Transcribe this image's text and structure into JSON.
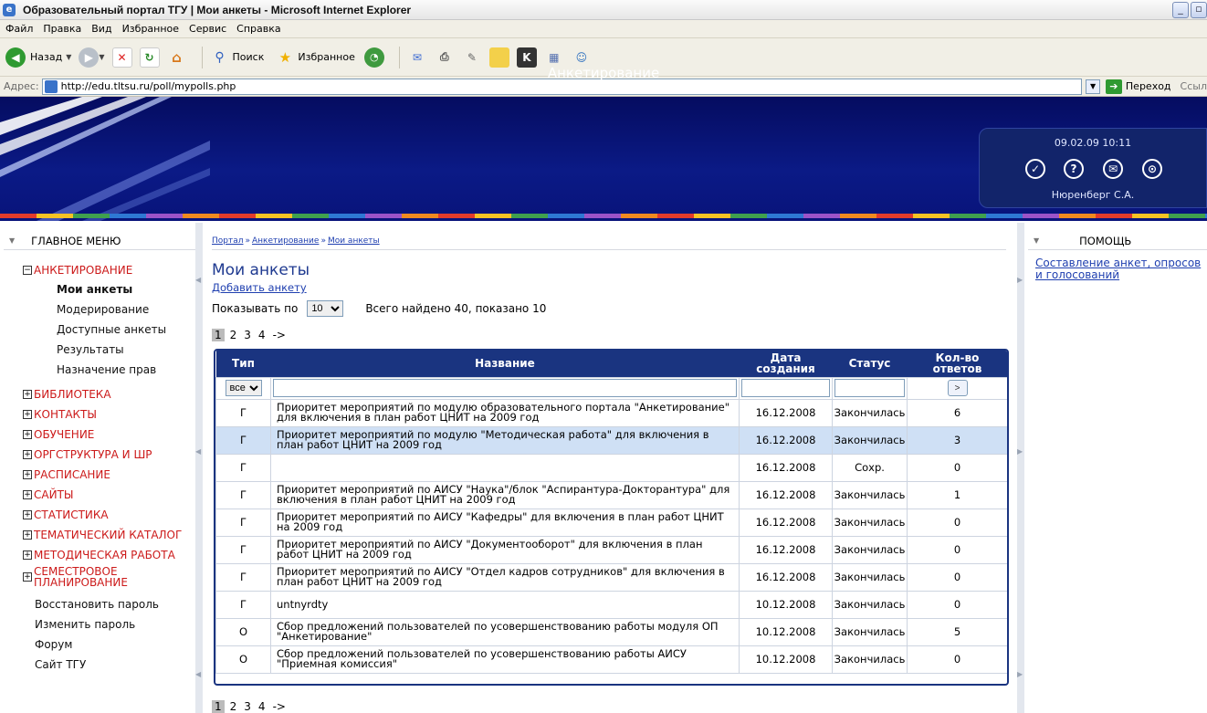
{
  "window": {
    "title": "Образовательный портал ТГУ | Мои анкеты - Microsoft Internet Explorer"
  },
  "menubar": [
    "Файл",
    "Правка",
    "Вид",
    "Избранное",
    "Сервис",
    "Справка"
  ],
  "toolbar": {
    "back": "Назад",
    "search": "Поиск",
    "favorites": "Избранное"
  },
  "address": {
    "label": "Адрес:",
    "url": "http://edu.tltsu.ru/poll/mypolls.php",
    "go": "Переход",
    "links": "Ссыл"
  },
  "header": {
    "title": "Анкетирование",
    "datetime": "09.02.09 10:11",
    "user": "Нюренберг С.А."
  },
  "left_menu": {
    "title": "ГЛАВНОЕ МЕНЮ",
    "active_section": "АНКЕТИРОВАНИЕ",
    "sub_items": [
      "Мои анкеты",
      "Модерирование",
      "Доступные анкеты",
      "Результаты",
      "Назначение прав"
    ],
    "sections": [
      "БИБЛИОТЕКА",
      "КОНТАКТЫ",
      "ОБУЧЕНИЕ",
      "ОРГСТРУКТУРА И ШР",
      "РАСПИСАНИЕ",
      "САЙТЫ",
      "СТАТИСТИКА",
      "ТЕМАТИЧЕСКИЙ КАТАЛОГ",
      "МЕТОДИЧЕСКАЯ РАБОТА"
    ],
    "semester_line1": "СЕМЕСТРОВОЕ",
    "semester_line2": "ПЛАНИРОВАНИЕ",
    "misc": [
      "Восстановить пароль",
      "Изменить пароль",
      "Форум",
      "Сайт ТГУ"
    ]
  },
  "breadcrumb": {
    "portal": "Портал",
    "section": "Анкетирование",
    "current": "Мои анкеты",
    "separator": "»"
  },
  "main": {
    "title": "Мои анкеты",
    "add_link": "Добавить анкету",
    "show_label": "Показывать по",
    "per_page": "10",
    "total": "Всего найдено 40, показано 10",
    "pages": [
      "1",
      "2",
      "3",
      "4",
      "->"
    ]
  },
  "table": {
    "headers": {
      "type": "Тип",
      "name": "Название",
      "created_line1": "Дата",
      "created_line2": "создания",
      "status": "Статус",
      "answers_line1": "Кол-во",
      "answers_line2": "ответов"
    },
    "filter": {
      "type": "все",
      "go": ">"
    },
    "rows": [
      {
        "type": "Г",
        "name": "Приоритет мероприятий по модулю образовательного портала \"Анкетирование\" для включения в план работ ЦНИТ на 2009 год",
        "created": "16.12.2008",
        "status": "Закончилась",
        "answers": "6"
      },
      {
        "type": "Г",
        "name": "Приоритет мероприятий по модулю \"Методическая работа\" для включения в план работ ЦНИТ на 2009 год",
        "created": "16.12.2008",
        "status": "Закончилась",
        "answers": "3"
      },
      {
        "type": "Г",
        "name": "",
        "created": "16.12.2008",
        "status": "Сохр.",
        "answers": "0"
      },
      {
        "type": "Г",
        "name": "Приоритет мероприятий по АИСУ \"Наука\"/блок \"Аспирантура-Докторантура\" для включения в план работ ЦНИТ на 2009 год",
        "created": "16.12.2008",
        "status": "Закончилась",
        "answers": "1"
      },
      {
        "type": "Г",
        "name": "Приоритет мероприятий по АИСУ \"Кафедры\" для включения в план работ ЦНИТ на 2009 год",
        "created": "16.12.2008",
        "status": "Закончилась",
        "answers": "0"
      },
      {
        "type": "Г",
        "name": "Приоритет мероприятий по АИСУ \"Документооборот\" для включения в план работ ЦНИТ на 2009 год",
        "created": "16.12.2008",
        "status": "Закончилась",
        "answers": "0"
      },
      {
        "type": "Г",
        "name": "Приоритет мероприятий по АИСУ \"Отдел кадров сотрудников\" для включения в план работ ЦНИТ на 2009 год",
        "created": "16.12.2008",
        "status": "Закончилась",
        "answers": "0"
      },
      {
        "type": "Г",
        "name": "untnyrdty",
        "created": "10.12.2008",
        "status": "Закончилась",
        "answers": "0"
      },
      {
        "type": "О",
        "name": "Сбор предложений пользователей по усовершенствованию работы модуля ОП \"Анкетирование\"",
        "created": "10.12.2008",
        "status": "Закончилась",
        "answers": "5"
      },
      {
        "type": "О",
        "name": "Сбор предложений пользователей по усовершенствованию работы АИСУ \"Приемная комиссия\"",
        "created": "10.12.2008",
        "status": "Закончилась",
        "answers": "0"
      }
    ]
  },
  "right_panel": {
    "title": "ПОМОЩЬ",
    "link": "Составление анкет, опросов и голосований"
  },
  "colors": {
    "header_bg": "#0b1a86",
    "table_head": "#1a3480",
    "menu_red": "#cc1a1a",
    "link_blue": "#2040b0",
    "row_highlight": "#cfe0f5"
  }
}
